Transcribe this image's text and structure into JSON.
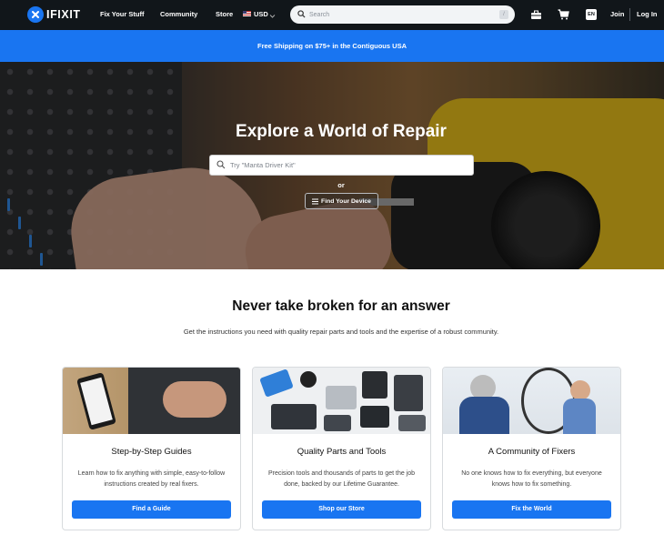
{
  "nav": {
    "logo_text": "IFIXIT",
    "links": [
      "Fix Your Stuff",
      "Community",
      "Store"
    ],
    "currency": "USD",
    "search_placeholder": "Search",
    "search_shortcut": "/",
    "lang": "EN",
    "join": "Join",
    "login": "Log In"
  },
  "banner": {
    "text": "Free Shipping on $75+ in the Contiguous USA"
  },
  "hero": {
    "title": "Explore a World of Repair",
    "search_placeholder": "Try \"Manta Driver Kit\"",
    "or": "or",
    "find_device": "Find Your Device"
  },
  "main": {
    "title": "Never take broken for an answer",
    "subtitle": "Get the instructions you need with quality repair parts and tools and the expertise of a robust community."
  },
  "cards": [
    {
      "title": "Step-by-Step Guides",
      "desc": "Learn how to fix anything with simple, easy-to-follow instructions created by real fixers.",
      "button": "Find a Guide"
    },
    {
      "title": "Quality Parts and Tools",
      "desc": "Precision tools and thousands of parts to get the job done, backed by our Lifetime Guarantee.",
      "button": "Shop our Store"
    },
    {
      "title": "A Community of Fixers",
      "desc": "No one knows how to fix everything, but everyone knows how to fix something.",
      "button": "Fix the World"
    }
  ],
  "colors": {
    "brand_blue": "#1975f1",
    "nav_bg": "#11161a"
  },
  "icons": [
    "ifixit-logo-icon",
    "us-flag-icon",
    "chevron-down-icon",
    "search-icon",
    "toolbox-icon",
    "cart-icon",
    "list-icon"
  ]
}
